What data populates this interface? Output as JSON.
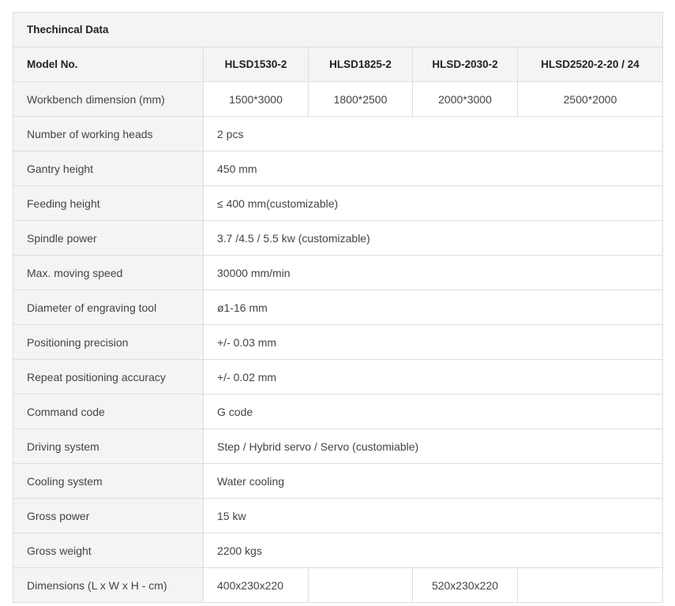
{
  "table_title": "Thechincal Data",
  "header": {
    "label": "Model No.",
    "models": [
      "HLSD1530-2",
      "HLSD1825-2",
      "HLSD-2030-2",
      "HLSD2520-2-20 / 24"
    ]
  },
  "workbench": {
    "label": "Workbench dimension (mm)",
    "values": [
      "1500*3000",
      "1800*2500",
      "2000*3000",
      "2500*2000"
    ]
  },
  "rows": [
    {
      "label": "Number of working heads",
      "value": "2 pcs"
    },
    {
      "label": "Gantry height",
      "value": "450 mm"
    },
    {
      "label": "Feeding height",
      "value": "≤ 400 mm(customizable)"
    },
    {
      "label": "Spindle power",
      "value": "3.7 /4.5 / 5.5 kw (customizable)"
    },
    {
      "label": "Max. moving speed",
      "value": "30000 mm/min"
    },
    {
      "label": "Diameter of engraving tool",
      "value": "ø1-16 mm"
    },
    {
      "label": "Positioning precision",
      "value": "+/- 0.03 mm"
    },
    {
      "label": "Repeat positioning accuracy",
      "value": "+/- 0.02 mm"
    },
    {
      "label": "Command code",
      "value": "G code"
    },
    {
      "label": "Driving system",
      "value": "Step / Hybrid servo / Servo (customiable)"
    },
    {
      "label": "Cooling system",
      "value": "Water cooling"
    },
    {
      "label": "Gross power",
      "value": "15 kw"
    },
    {
      "label": "Gross weight",
      "value": "2200 kgs"
    }
  ],
  "dimensions": {
    "label": "Dimensions (L x W x H - cm)",
    "values": [
      "400x230x220",
      "",
      "520x230x220",
      ""
    ]
  }
}
